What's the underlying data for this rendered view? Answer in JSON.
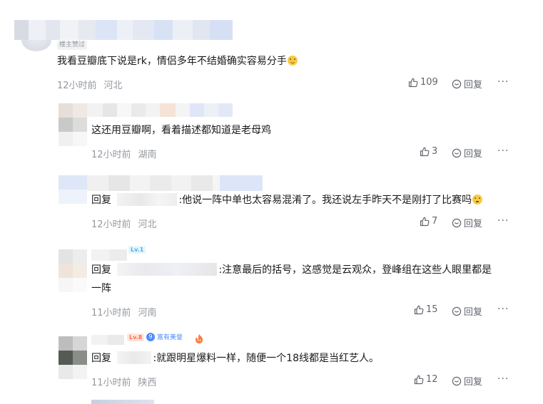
{
  "top_comment": {
    "author_tag": "楼主赞过",
    "text": "我看豆瓣底下说是rk，情侣多年不结婚确实容易分手",
    "time": "12小时前",
    "location": "河北",
    "likes": "109",
    "reply_label": "回复",
    "more": "···"
  },
  "replies": [
    {
      "text": "这还用豆瓣啊，看着描述都知道是老母鸡",
      "time": "12小时前",
      "location": "湖南",
      "likes": "3",
      "reply_label": "回复",
      "more": "···"
    },
    {
      "prefix": "回复",
      "text": ":他说一阵中单也太容易混淆了。我还说左手昨天不是刚打了比赛吗",
      "time": "12小时前",
      "location": "河北",
      "likes": "7",
      "reply_label": "回复",
      "more": "···"
    },
    {
      "level": "Lv.1",
      "prefix": "回复",
      "text_line1": ":注意最后的括号，这感觉是云观众，登峰组在这些人眼里都是",
      "text_line2": "一阵",
      "time": "11小时前",
      "location": "河南",
      "likes": "15",
      "reply_label": "回复",
      "more": "···"
    },
    {
      "level": "Lv.8",
      "badge": "富有美誉",
      "prefix": "回复",
      "text": ":就跟明星爆料一样，随便一个18线都是当红艺人。",
      "time": "11小时前",
      "location": "陕西",
      "likes": "12",
      "reply_label": "回复",
      "more": "···"
    }
  ],
  "colors": {
    "text": "#18191c",
    "meta": "#9499a0",
    "action": "#61666d",
    "emoji": "#f7c948",
    "lv1": "#3fb4f1",
    "lv8": "#ff6b4a",
    "badge": "#4d8bff"
  },
  "icons": [
    "thumbs-up-icon",
    "reply-bubble-icon",
    "more-icon",
    "emoji-smile-icon",
    "emoji-sad-icon",
    "medal-icon",
    "fire-icon"
  ]
}
